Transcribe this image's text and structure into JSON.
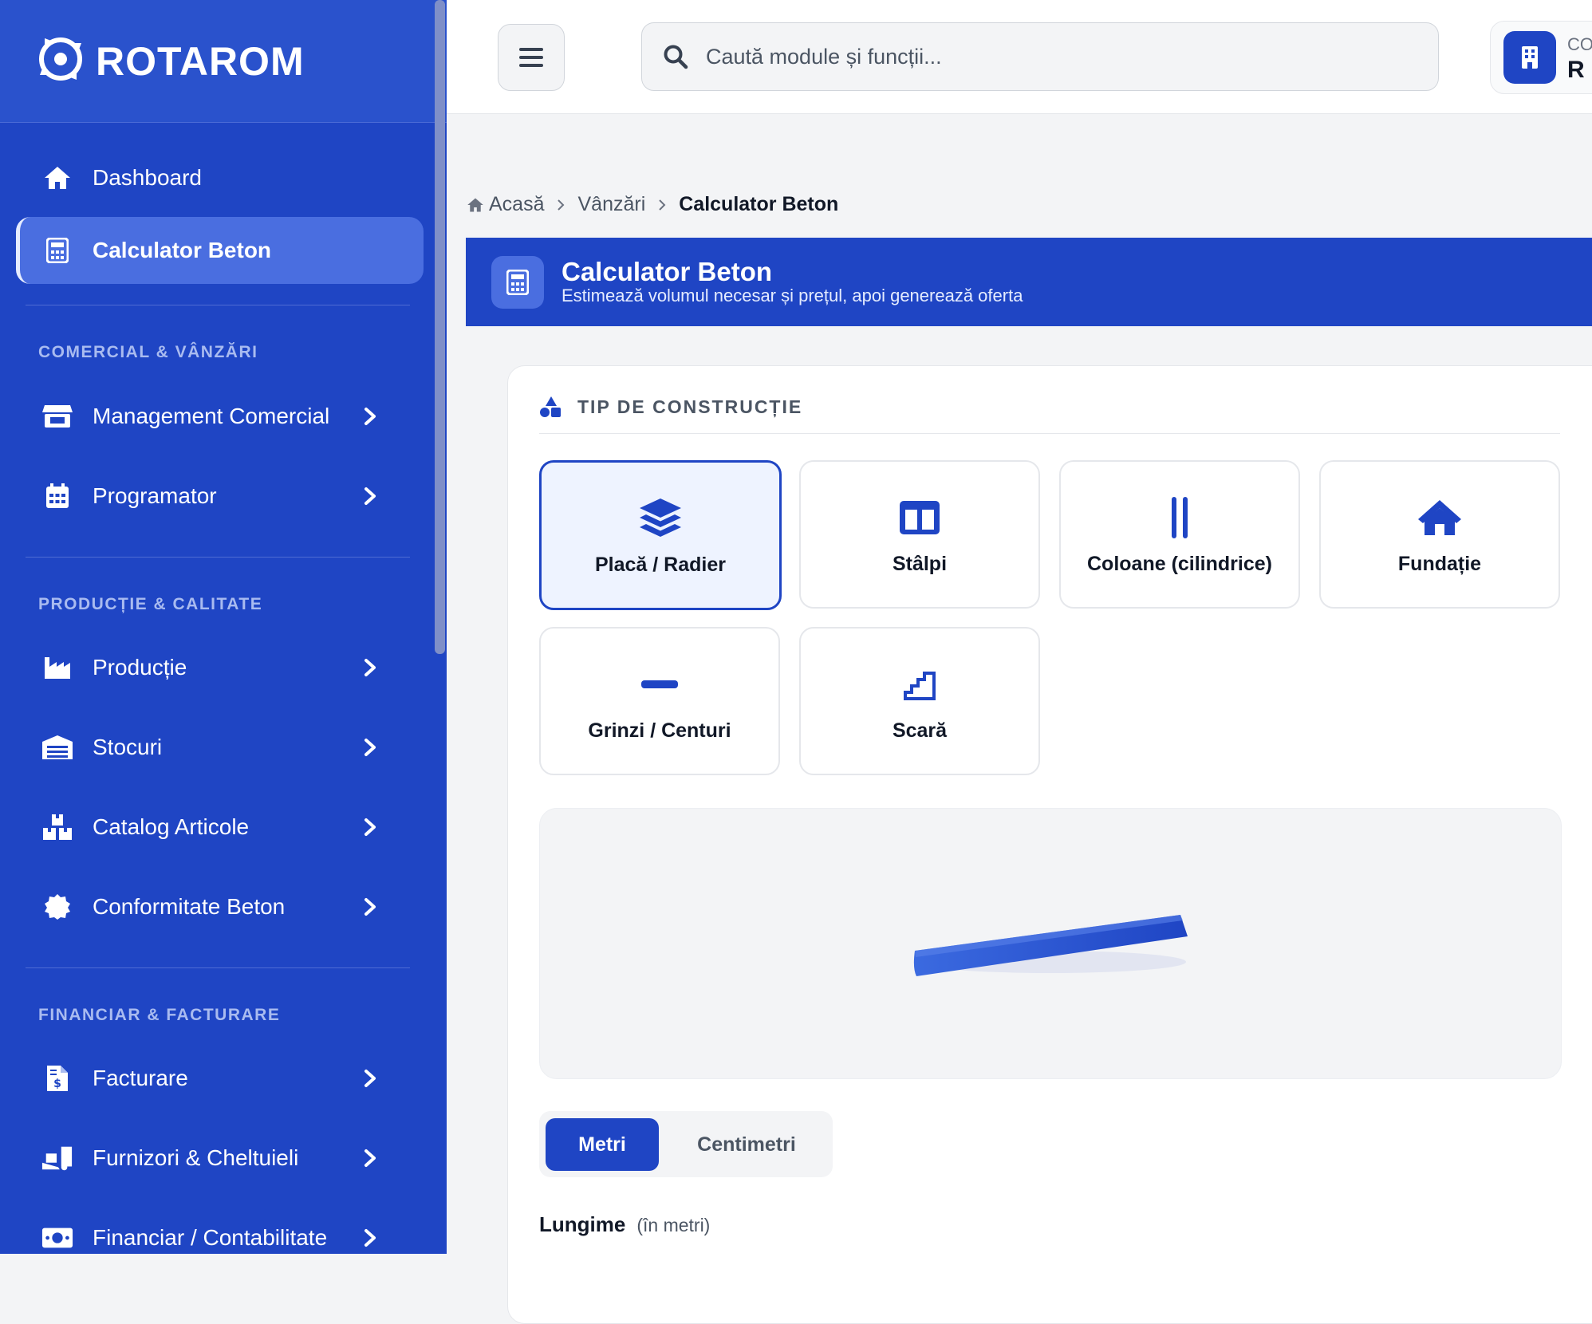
{
  "brand": {
    "name": "ROTAROM"
  },
  "sidebar": {
    "nav": [
      {
        "label": "Dashboard",
        "icon": "home-icon"
      },
      {
        "label": "Calculator Beton",
        "icon": "calculator-icon",
        "active": true
      }
    ],
    "sections": [
      {
        "title": "COMERCIAL & VÂNZĂRI",
        "items": [
          {
            "label": "Management Comercial",
            "icon": "store-icon"
          },
          {
            "label": "Programator",
            "icon": "calendar-icon"
          }
        ]
      },
      {
        "title": "PRODUCȚIE & CALITATE",
        "items": [
          {
            "label": "Producție",
            "icon": "industry-icon"
          },
          {
            "label": "Stocuri",
            "icon": "warehouse-icon"
          },
          {
            "label": "Catalog Articole",
            "icon": "boxes-icon"
          },
          {
            "label": "Conformitate Beton",
            "icon": "certificate-icon"
          }
        ]
      },
      {
        "title": "FINANCIAR & FACTURARE",
        "items": [
          {
            "label": "Facturare",
            "icon": "invoice-icon"
          },
          {
            "label": "Furnizori & Cheltuieli",
            "icon": "truck-loading-icon"
          },
          {
            "label": "Financiar / Contabilitate",
            "icon": "money-bill-icon"
          }
        ]
      }
    ]
  },
  "topbar": {
    "search_placeholder": "Caută module și funcții...",
    "company_line1": "CO",
    "company_line2": "R"
  },
  "breadcrumb": {
    "home": "Acasă",
    "parent": "Vânzări",
    "current": "Calculator Beton"
  },
  "header": {
    "title": "Calculator Beton",
    "subtitle": "Estimează volumul necesar și prețul, apoi generează oferta"
  },
  "construction": {
    "heading": "TIP DE CONSTRUCȚIE",
    "options": [
      {
        "label": "Placă / Radier",
        "icon": "layers-icon",
        "selected": true
      },
      {
        "label": "Stâlpi",
        "icon": "columns-icon"
      },
      {
        "label": "Coloane (cilindrice)",
        "icon": "grip-lines-vertical-icon"
      },
      {
        "label": "Fundație",
        "icon": "house-icon"
      },
      {
        "label": "Grinzi / Centuri",
        "icon": "minus-icon"
      },
      {
        "label": "Scară",
        "icon": "stairs-icon"
      }
    ]
  },
  "units": {
    "options": [
      "Metri",
      "Centimetri"
    ],
    "selected": "Metri"
  },
  "fields": {
    "length_label": "Lungime",
    "length_hint": "(în metri)"
  },
  "colors": {
    "primary": "#1f45c4",
    "sidebar": "#1f45c4",
    "selected_bg": "#eef3ff"
  }
}
